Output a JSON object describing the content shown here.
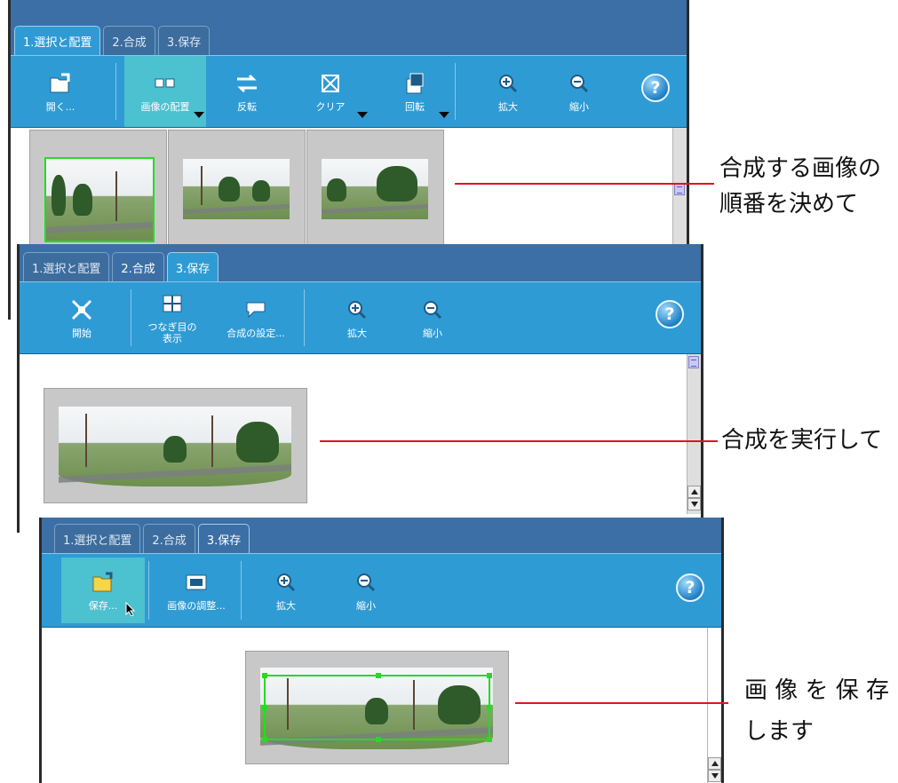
{
  "panel1": {
    "tabs": [
      "1.選択と配置",
      "2.合成",
      "3.保存"
    ],
    "toolbar": [
      {
        "icon": "open-folder-icon",
        "label": "開く..."
      },
      {
        "icon": "arrange-images-icon",
        "label": "画像の配置"
      },
      {
        "icon": "flip-icon",
        "label": "反転"
      },
      {
        "icon": "clear-icon",
        "label": "クリア"
      },
      {
        "icon": "rotate-icon",
        "label": "回転"
      },
      {
        "icon": "zoom-in-icon",
        "label": "拡大"
      },
      {
        "icon": "zoom-out-icon",
        "label": "縮小"
      }
    ],
    "help": "?"
  },
  "panel2": {
    "tabs": [
      "1.選択と配置",
      "2.合成",
      "3.保存"
    ],
    "toolbar": [
      {
        "icon": "start-stitch-icon",
        "label": "開始"
      },
      {
        "icon": "seam-display-icon",
        "label": "つなぎ目の\n表示"
      },
      {
        "icon": "stitch-settings-icon",
        "label": "合成の設定..."
      },
      {
        "icon": "zoom-in-icon",
        "label": "拡大"
      },
      {
        "icon": "zoom-out-icon",
        "label": "縮小"
      }
    ],
    "help": "?"
  },
  "panel3": {
    "tabs": [
      "1.選択と配置",
      "2.合成",
      "3.保存"
    ],
    "toolbar": [
      {
        "icon": "save-folder-icon",
        "label": "保存..."
      },
      {
        "icon": "image-adjust-icon",
        "label": "画像の調整..."
      },
      {
        "icon": "zoom-in-icon",
        "label": "拡大"
      },
      {
        "icon": "zoom-out-icon",
        "label": "縮小"
      }
    ],
    "help": "?"
  },
  "annotations": {
    "step1": [
      "合成する画像の",
      "順番を決めて"
    ],
    "step2": "合成を実行して",
    "step3": [
      "画 像 を 保 存",
      "します"
    ]
  },
  "colors": {
    "tab_bar": "#3b6fa6",
    "toolbar": "#2f9bd4",
    "active_button": "#4cc1cf",
    "annotation_line": "#e0141c",
    "selection": "#22dd22"
  }
}
